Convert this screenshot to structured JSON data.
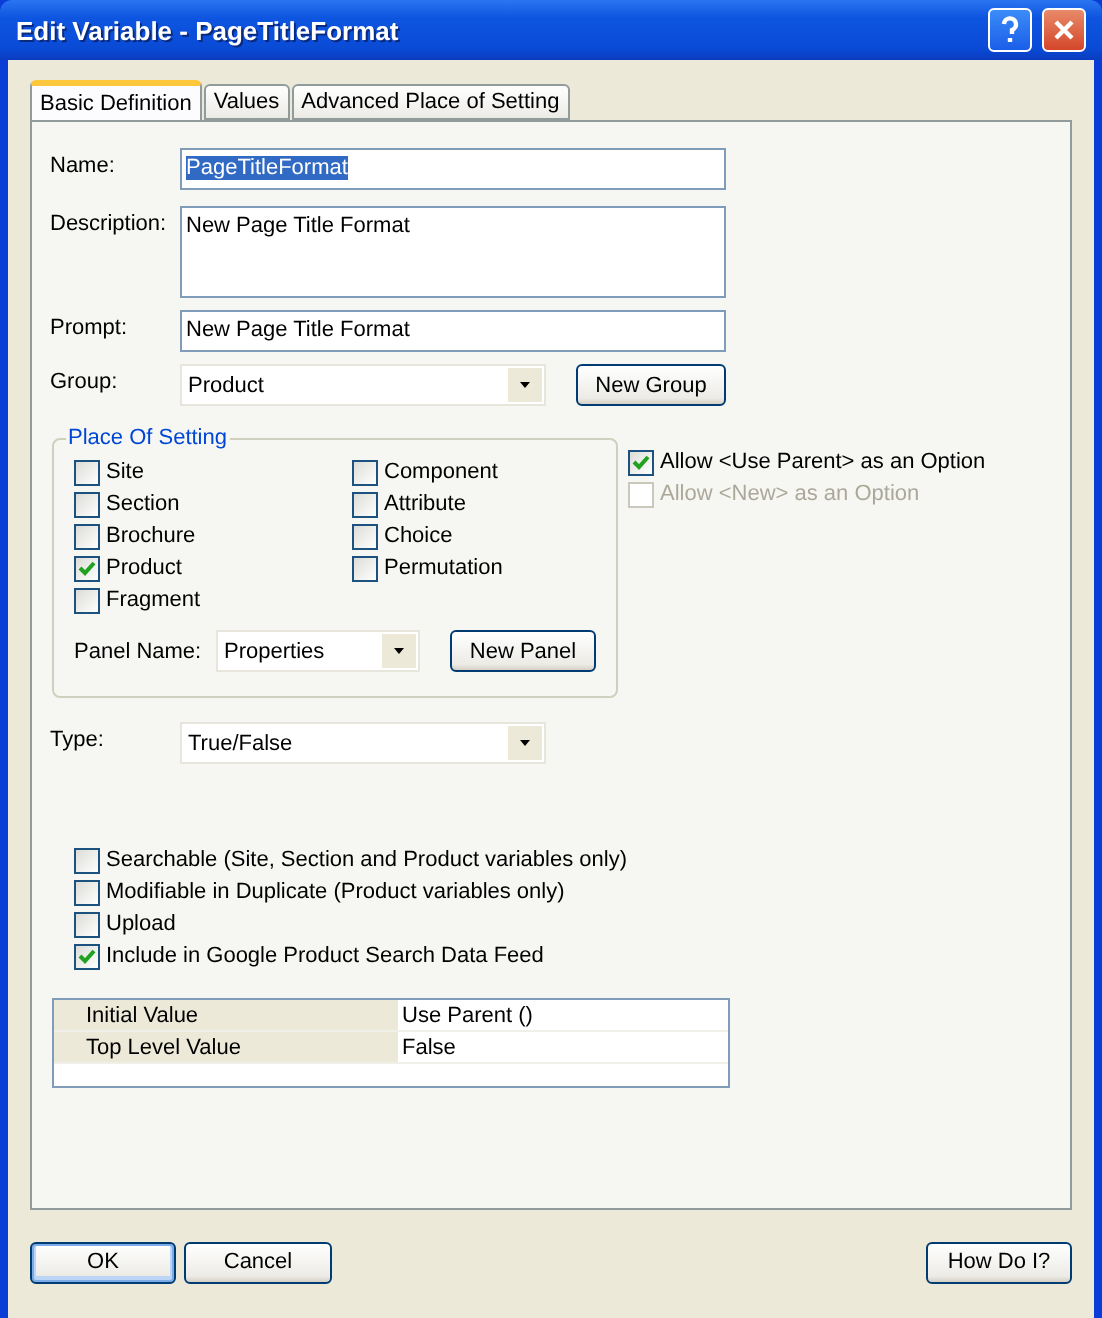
{
  "window": {
    "title": "Edit Variable - PageTitleFormat"
  },
  "tabs": [
    {
      "label": "Basic Definition",
      "selected": true
    },
    {
      "label": "Values",
      "selected": false
    },
    {
      "label": "Advanced Place of Setting",
      "selected": false
    }
  ],
  "fields": [
    {
      "kind": "text",
      "label": "Name:",
      "value": "PageTitleFormat",
      "text_selected": true
    },
    {
      "kind": "textarea",
      "label": "Description:",
      "value": "New Page Title Format",
      "text_selected": false
    },
    {
      "kind": "text",
      "label": "Prompt:",
      "value": "New Page Title Format",
      "text_selected": false
    },
    {
      "kind": "dropdown",
      "label": "Group:",
      "value": "Product",
      "button": "New Group"
    }
  ],
  "place_of_setting": {
    "title": "Place Of Setting",
    "options": [
      {
        "label": "Site",
        "checked": false
      },
      {
        "label": "Section",
        "checked": false
      },
      {
        "label": "Brochure",
        "checked": false
      },
      {
        "label": "Product",
        "checked": true
      },
      {
        "label": "Fragment",
        "checked": false
      },
      {
        "label": "Component",
        "checked": false
      },
      {
        "label": "Attribute",
        "checked": false
      },
      {
        "label": "Choice",
        "checked": false
      },
      {
        "label": "Permutation",
        "checked": false
      }
    ],
    "panel": {
      "label": "Panel Name:",
      "value": "Properties",
      "button": "New Panel"
    }
  },
  "side_options": [
    {
      "label": "Allow <Use Parent> as an Option",
      "checked": true,
      "disabled": false
    },
    {
      "label": "Allow <New> as an Option",
      "checked": false,
      "disabled": true
    }
  ],
  "type": {
    "label": "Type:",
    "value": "True/False"
  },
  "flags": [
    {
      "label": "Searchable (Site, Section and Product variables only)",
      "checked": false
    },
    {
      "label": "Modifiable in Duplicate (Product variables only)",
      "checked": false
    },
    {
      "label": "Upload",
      "checked": false
    },
    {
      "label": "Include in Google Product Search Data Feed",
      "checked": true
    }
  ],
  "properties": [
    {
      "name": "Initial Value",
      "value": "Use Parent ()"
    },
    {
      "name": "Top Level Value",
      "value": "False"
    }
  ],
  "buttons": [
    {
      "label": "OK",
      "default": true
    },
    {
      "label": "Cancel",
      "default": false
    }
  ],
  "help_button": "How Do I?"
}
